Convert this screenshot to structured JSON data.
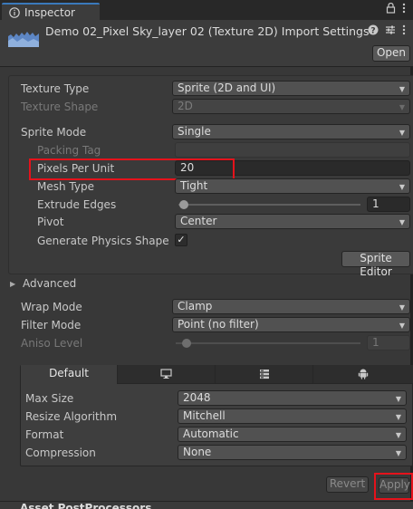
{
  "window": {
    "tab_label": "Inspector",
    "tab_icon": "info-icon",
    "tab_icons": [
      "lock-icon",
      "kebab-menu-icon"
    ]
  },
  "header": {
    "title": "Demo 02_Pixel Sky_layer 02 (Texture 2D) Import Settings",
    "icons": [
      "help-icon",
      "preset-icon",
      "kebab-menu-icon"
    ],
    "open_label": "Open"
  },
  "settings": {
    "texture_type": {
      "label": "Texture Type",
      "value": "Sprite (2D and UI)"
    },
    "texture_shape": {
      "label": "Texture Shape",
      "value": "2D"
    },
    "sprite_mode": {
      "label": "Sprite Mode",
      "value": "Single"
    },
    "packing_tag": {
      "label": "Packing Tag",
      "value": ""
    },
    "pixels_per_unit": {
      "label": "Pixels Per Unit",
      "value": "20"
    },
    "mesh_type": {
      "label": "Mesh Type",
      "value": "Tight"
    },
    "extrude_edges": {
      "label": "Extrude Edges",
      "value": "1",
      "fraction": 0.0
    },
    "pivot": {
      "label": "Pivot",
      "value": "Center"
    },
    "generate_physics_shape": {
      "label": "Generate Physics Shape",
      "checked": true,
      "check_glyph": "✓"
    },
    "sprite_editor_label": "Sprite Editor",
    "advanced_label": "Advanced",
    "wrap_mode": {
      "label": "Wrap Mode",
      "value": "Clamp"
    },
    "filter_mode": {
      "label": "Filter Mode",
      "value": "Point (no filter)"
    },
    "aniso_level": {
      "label": "Aniso Level",
      "value": "1",
      "fraction": 0.0
    }
  },
  "platform": {
    "tabs": [
      {
        "label": "Default",
        "icon": ""
      },
      {
        "label": "",
        "icon": "monitor-icon"
      },
      {
        "label": "",
        "icon": "webgl-icon"
      },
      {
        "label": "",
        "icon": "android-icon"
      }
    ],
    "max_size": {
      "label": "Max Size",
      "value": "2048"
    },
    "resize_algorithm": {
      "label": "Resize Algorithm",
      "value": "Mitchell"
    },
    "format": {
      "label": "Format",
      "value": "Automatic"
    },
    "compression": {
      "label": "Compression",
      "value": "None"
    }
  },
  "actions": {
    "revert_label": "Revert",
    "apply_label": "Apply"
  },
  "footer": {
    "section_label": "Asset PostProcessors"
  },
  "colors": {
    "highlight": "#e5121b",
    "tab_accent": "#3a79bb"
  }
}
